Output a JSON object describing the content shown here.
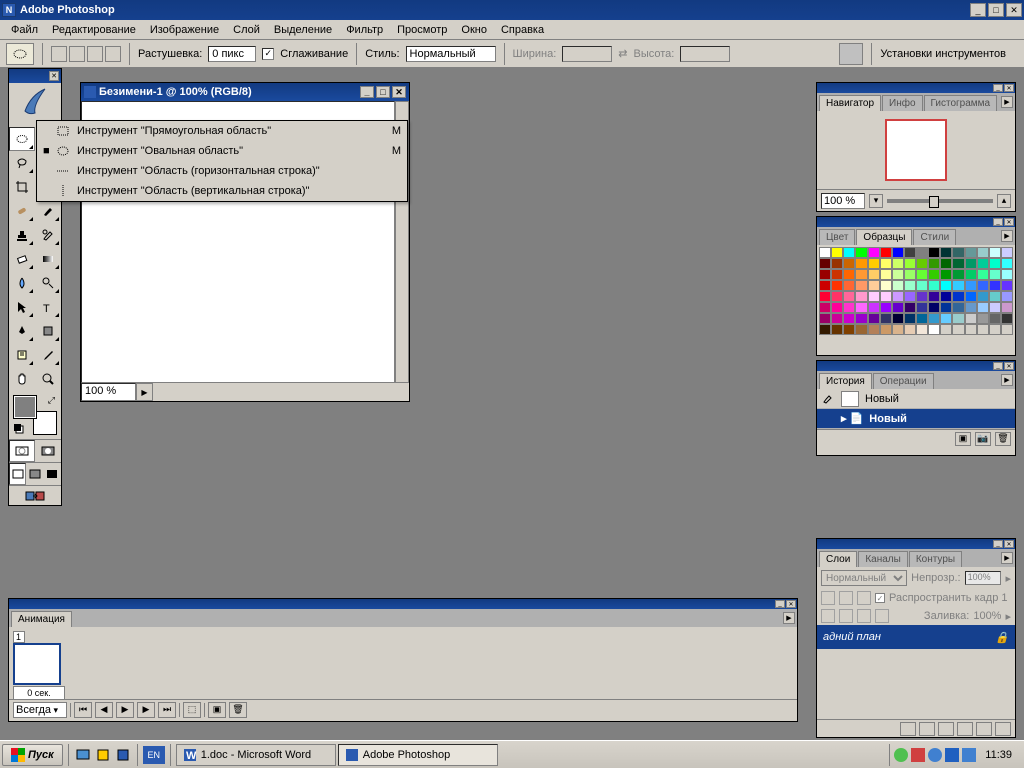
{
  "app": {
    "title": "Adobe Photoshop"
  },
  "menu": [
    "Файл",
    "Редактирование",
    "Изображение",
    "Слой",
    "Выделение",
    "Фильтр",
    "Просмотр",
    "Окно",
    "Справка"
  ],
  "options": {
    "feather_label": "Растушевка:",
    "feather_value": "0 пикс",
    "antialias_label": "Сглаживание",
    "style_label": "Стиль:",
    "style_value": "Нормальный",
    "width_label": "Ширина:",
    "height_label": "Высота:",
    "palette_label": "Установки инструментов"
  },
  "document": {
    "title": "Безимени-1 @ 100% (RGB/8)",
    "zoom": "100 %"
  },
  "flyout": [
    {
      "label": "Инструмент \"Прямоугольная область\"",
      "key": "M",
      "selected": false,
      "icon": "rect"
    },
    {
      "label": "Инструмент \"Овальная область\"",
      "key": "M",
      "selected": true,
      "icon": "ellipse"
    },
    {
      "label": "Инструмент \"Область (горизонтальная строка)\"",
      "key": "",
      "selected": false,
      "icon": "hrow"
    },
    {
      "label": "Инструмент \"Область (вертикальная строка)\"",
      "key": "",
      "selected": false,
      "icon": "vrow"
    }
  ],
  "navigator": {
    "tab1": "Навигатор",
    "tab2": "Инфо",
    "tab3": "Гистограмма",
    "zoom": "100 %"
  },
  "swatches": {
    "tab1": "Цвет",
    "tab2": "Образцы",
    "tab3": "Стили"
  },
  "history": {
    "tab1": "История",
    "tab2": "Операции",
    "snapshot": "Новый",
    "state": "Новый"
  },
  "layers": {
    "tab1": "Слои",
    "tab2": "Каналы",
    "tab3": "Контуры",
    "blend": "Нормальный",
    "opacity_label": "Непрозр.:",
    "opacity": "100%",
    "propagate": "Распространить кадр 1",
    "fill_label": "Заливка:",
    "fill": "100%",
    "layer_name": "адний план"
  },
  "animation": {
    "tab": "Анимация",
    "frame_time": "0 сек.",
    "loop": "Всегда"
  },
  "taskbar": {
    "start": "Пуск",
    "task1": "1.doc - Microsoft Word",
    "task2": "Adobe Photoshop",
    "clock": "11:39",
    "lang": "EN"
  },
  "swatch_colors": [
    "#ffffff",
    "#ffff00",
    "#00ffff",
    "#00ff00",
    "#ff00ff",
    "#ff0000",
    "#0000ff",
    "#404040",
    "#808080",
    "#000000",
    "#003333",
    "#336666",
    "#669999",
    "#99cccc",
    "#ccffff",
    "#ccccff",
    "#660000",
    "#993300",
    "#cc6600",
    "#ff9900",
    "#ffcc00",
    "#ffff66",
    "#ccff66",
    "#99ff33",
    "#66cc00",
    "#339900",
    "#006600",
    "#006633",
    "#009966",
    "#00cc99",
    "#00ffcc",
    "#33ffff",
    "#990000",
    "#cc3300",
    "#ff6600",
    "#ff9933",
    "#ffcc66",
    "#ffff99",
    "#ccff99",
    "#99ff66",
    "#66ff33",
    "#33cc00",
    "#009900",
    "#009933",
    "#00cc66",
    "#33ff99",
    "#66ffcc",
    "#99ffff",
    "#cc0000",
    "#ff3300",
    "#ff6633",
    "#ff9966",
    "#ffcc99",
    "#ffffcc",
    "#ccffcc",
    "#99ffcc",
    "#66ffcc",
    "#33ffcc",
    "#00ffff",
    "#33ccff",
    "#3399ff",
    "#3366ff",
    "#3333ff",
    "#6633ff",
    "#ff0033",
    "#ff3366",
    "#ff6699",
    "#ff99cc",
    "#ffccff",
    "#ffccff",
    "#cc99ff",
    "#9966ff",
    "#6633cc",
    "#330099",
    "#000099",
    "#0033cc",
    "#0066ff",
    "#3399cc",
    "#66cccc",
    "#9999ff",
    "#cc0066",
    "#ff0099",
    "#ff33cc",
    "#ff66ff",
    "#cc33ff",
    "#9900ff",
    "#6600cc",
    "#330066",
    "#333399",
    "#000066",
    "#003399",
    "#336699",
    "#6699cc",
    "#99ccff",
    "#ccccff",
    "#cc99cc",
    "#990066",
    "#cc0099",
    "#cc00cc",
    "#9900cc",
    "#660099",
    "#333366",
    "#000033",
    "#003366",
    "#006699",
    "#3399cc",
    "#66ccff",
    "#99cccc",
    "#cccccc",
    "#999999",
    "#666666",
    "#333333",
    "#331a00",
    "#663300",
    "#804000",
    "#996633",
    "#b38059",
    "#cc9966",
    "#d9b38c",
    "#e6ccb3",
    "#f2e6d9",
    "#ffffff",
    "#d4d0c8",
    "#d4d0c8",
    "#d4d0c8",
    "#d4d0c8",
    "#d4d0c8",
    "#d4d0c8"
  ]
}
